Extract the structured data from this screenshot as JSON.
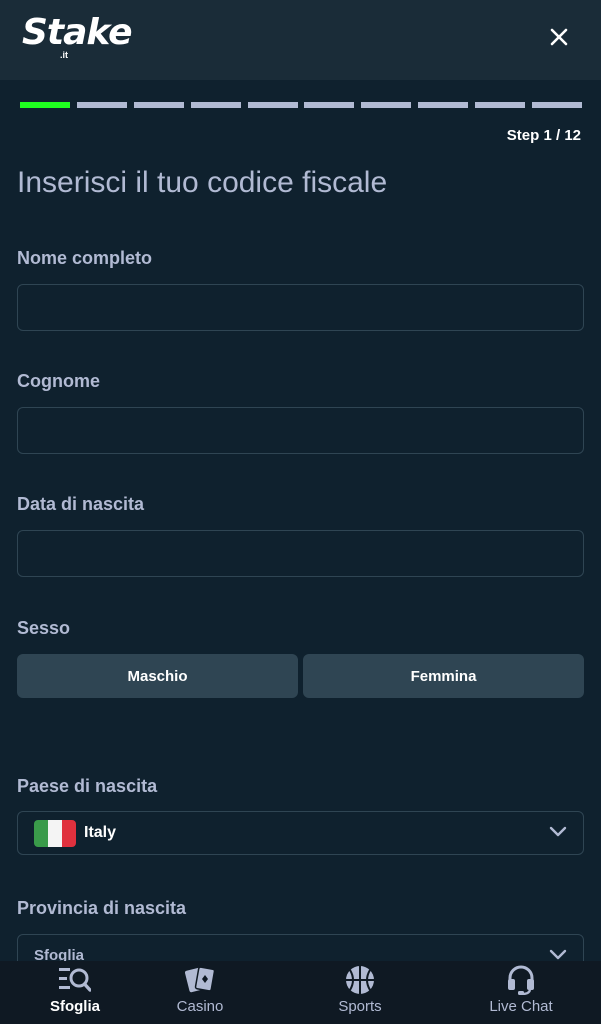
{
  "header": {
    "logo_text": "Stake",
    "logo_sub": ".it",
    "close_icon": "close-icon"
  },
  "progress": {
    "current_step": 1,
    "total_steps": 12,
    "step_label": "Step 1 / 12",
    "active_color": "#1fff20"
  },
  "form": {
    "title": "Inserisci il tuo codice fiscale",
    "full_name": {
      "label": "Nome completo",
      "value": ""
    },
    "surname": {
      "label": "Cognome",
      "value": ""
    },
    "birth_date": {
      "label": "Data di nascita",
      "value": ""
    },
    "gender": {
      "label": "Sesso",
      "options": [
        "Maschio",
        "Femmina"
      ]
    },
    "birth_country": {
      "label": "Paese di nascita",
      "value": "Italy",
      "flag": "italy-flag-icon"
    },
    "birth_province": {
      "label": "Provincia di nascita",
      "value": "Sfoglia"
    }
  },
  "bottom_nav": {
    "items": [
      {
        "label": "Sfoglia",
        "icon": "browse-icon",
        "active": true
      },
      {
        "label": "Casino",
        "icon": "cards-icon",
        "active": false
      },
      {
        "label": "Sports",
        "icon": "basketball-icon",
        "active": false
      },
      {
        "label": "Live Chat",
        "icon": "headset-icon",
        "active": false
      }
    ]
  },
  "colors": {
    "background": "#0f212e",
    "header": "#1a2c38",
    "button": "#2f4553",
    "text_muted": "#b1bad3"
  }
}
